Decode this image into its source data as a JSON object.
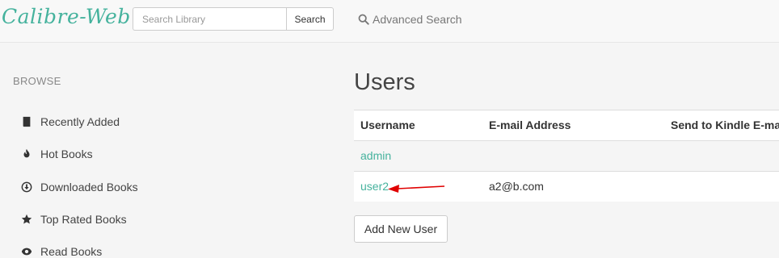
{
  "app": {
    "logo_text": "Calibre-Web",
    "brand_color": "#45b29d"
  },
  "header": {
    "search_placeholder": "Search Library",
    "search_button": "Search",
    "advanced_search": "Advanced Search"
  },
  "sidebar": {
    "heading": "BROWSE",
    "items": [
      {
        "label": "Recently Added",
        "icon": "book-icon"
      },
      {
        "label": "Hot Books",
        "icon": "fire-icon"
      },
      {
        "label": "Downloaded Books",
        "icon": "download-circle-icon"
      },
      {
        "label": "Top Rated Books",
        "icon": "star-icon"
      },
      {
        "label": "Read Books",
        "icon": "eye-icon"
      }
    ]
  },
  "main": {
    "title": "Users",
    "table": {
      "headers": [
        "Username",
        "E-mail Address",
        "Send to Kindle E-mail"
      ],
      "rows": [
        {
          "username": "admin",
          "email": "",
          "kindle": ""
        },
        {
          "username": "user2",
          "email": "a2@b.com",
          "kindle": ""
        }
      ]
    },
    "add_user_button": "Add New User"
  },
  "annotation": {
    "arrow_color": "#e00000"
  }
}
